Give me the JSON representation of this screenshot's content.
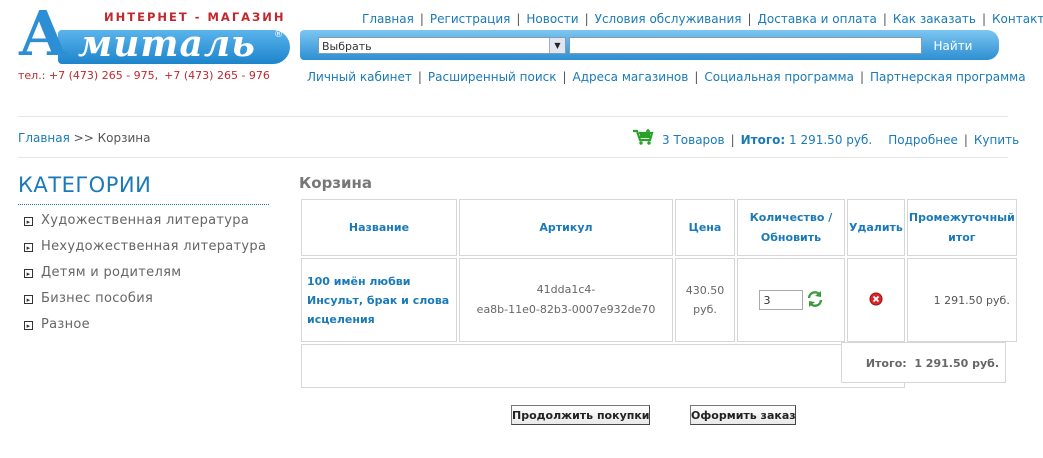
{
  "logo": {
    "tagline": "ИНТЕРНЕТ - МАГАЗИН",
    "initial": "А",
    "word": "миталь",
    "registered": "®"
  },
  "phones": [
    "тел.: +7 (473) 265 - 975,",
    "+7 (473) 265 - 976"
  ],
  "top_nav": [
    "Главная",
    "Регистрация",
    "Новости",
    "Условия обслуживания",
    "Доставка и оплата",
    "Как заказать",
    "Контакты"
  ],
  "search": {
    "select_value": "Выбрать",
    "input_value": "",
    "button_label": "Найти"
  },
  "sub_nav": [
    "Личный кабинет",
    "Расширенный поиск",
    "Адреса магазинов",
    "Социальная программа",
    "Партнерская программа"
  ],
  "breadcrumb": {
    "home": "Главная",
    "separator": ">>",
    "current": "Корзина"
  },
  "cart_summary": {
    "count": "3 Товаров",
    "total_label": "Итого:",
    "total": "1 291.50 руб.",
    "details": "Подробнее",
    "buy": "Купить"
  },
  "sidebar": {
    "title": "КАТЕГОРИИ",
    "items": [
      "Художественная литература",
      "Нехудожественная литература",
      "Детям и родителям",
      "Бизнес пособия",
      "Разное"
    ]
  },
  "page_title": "Корзина",
  "table": {
    "headers": {
      "name": "Название",
      "article": "Артикул",
      "price": "Цена",
      "qty_a": "Количество /",
      "qty_b": "Обновить",
      "delete": "Удалить",
      "subtotal_a": "Промежуточный",
      "subtotal_b": "итог"
    },
    "rows": [
      {
        "name_lines": [
          "100 имён любви",
          "Инсульт, брак и слова",
          "исцеления"
        ],
        "article_lines": [
          "41dda1c4-",
          "ea8b-11e0-82b3-0007e932de70"
        ],
        "price_lines": [
          "430.50",
          "руб."
        ],
        "quantity": "3",
        "subtotal": "1 291.50 руб."
      }
    ],
    "total_label": "Итого:",
    "total_value": "1 291.50 руб."
  },
  "buttons": {
    "continue": "Продолжить покупки",
    "checkout": "Оформить заказ"
  },
  "colors": {
    "link": "#1a7ab8",
    "brand_blue": "#2c8fd6",
    "brand_red": "#c1272d",
    "cart_green": "#2aa12a"
  }
}
